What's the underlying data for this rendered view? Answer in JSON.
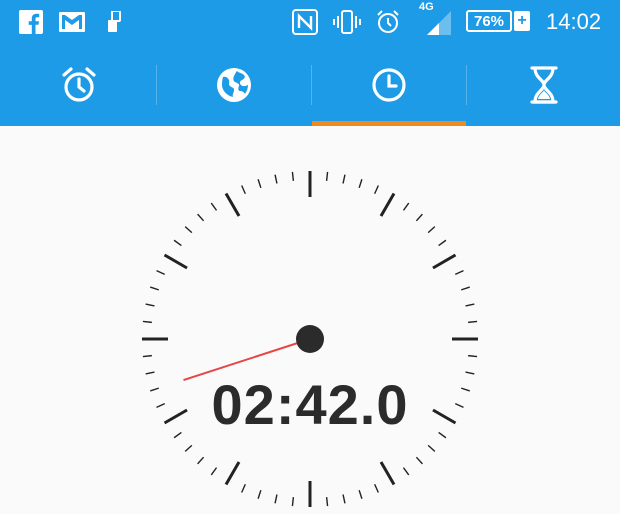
{
  "status_bar": {
    "notification_icons": [
      "facebook-icon",
      "gmail-icon",
      "usb-device-icon"
    ],
    "system_icons": [
      "nfc-icon",
      "vibrate-icon",
      "alarm-icon",
      "signal-icon"
    ],
    "network_type": "4G",
    "battery_percent": "76%",
    "battery_charging_symbol": "+",
    "time": "14:02"
  },
  "tabs": [
    {
      "id": "alarm",
      "icon": "alarm-clock-icon",
      "selected": false
    },
    {
      "id": "world-clock",
      "icon": "globe-icon",
      "selected": false
    },
    {
      "id": "stopwatch",
      "icon": "clock-icon",
      "selected": true
    },
    {
      "id": "timer",
      "icon": "hourglass-icon",
      "selected": false
    }
  ],
  "colors": {
    "primary": "#1e9be6",
    "indicator": "#f08a1e",
    "hand": "#e64545",
    "tick": "#222222",
    "background": "#fafafa"
  },
  "stopwatch": {
    "elapsed": "02:42.0",
    "elapsed_seconds": 42.0
  }
}
